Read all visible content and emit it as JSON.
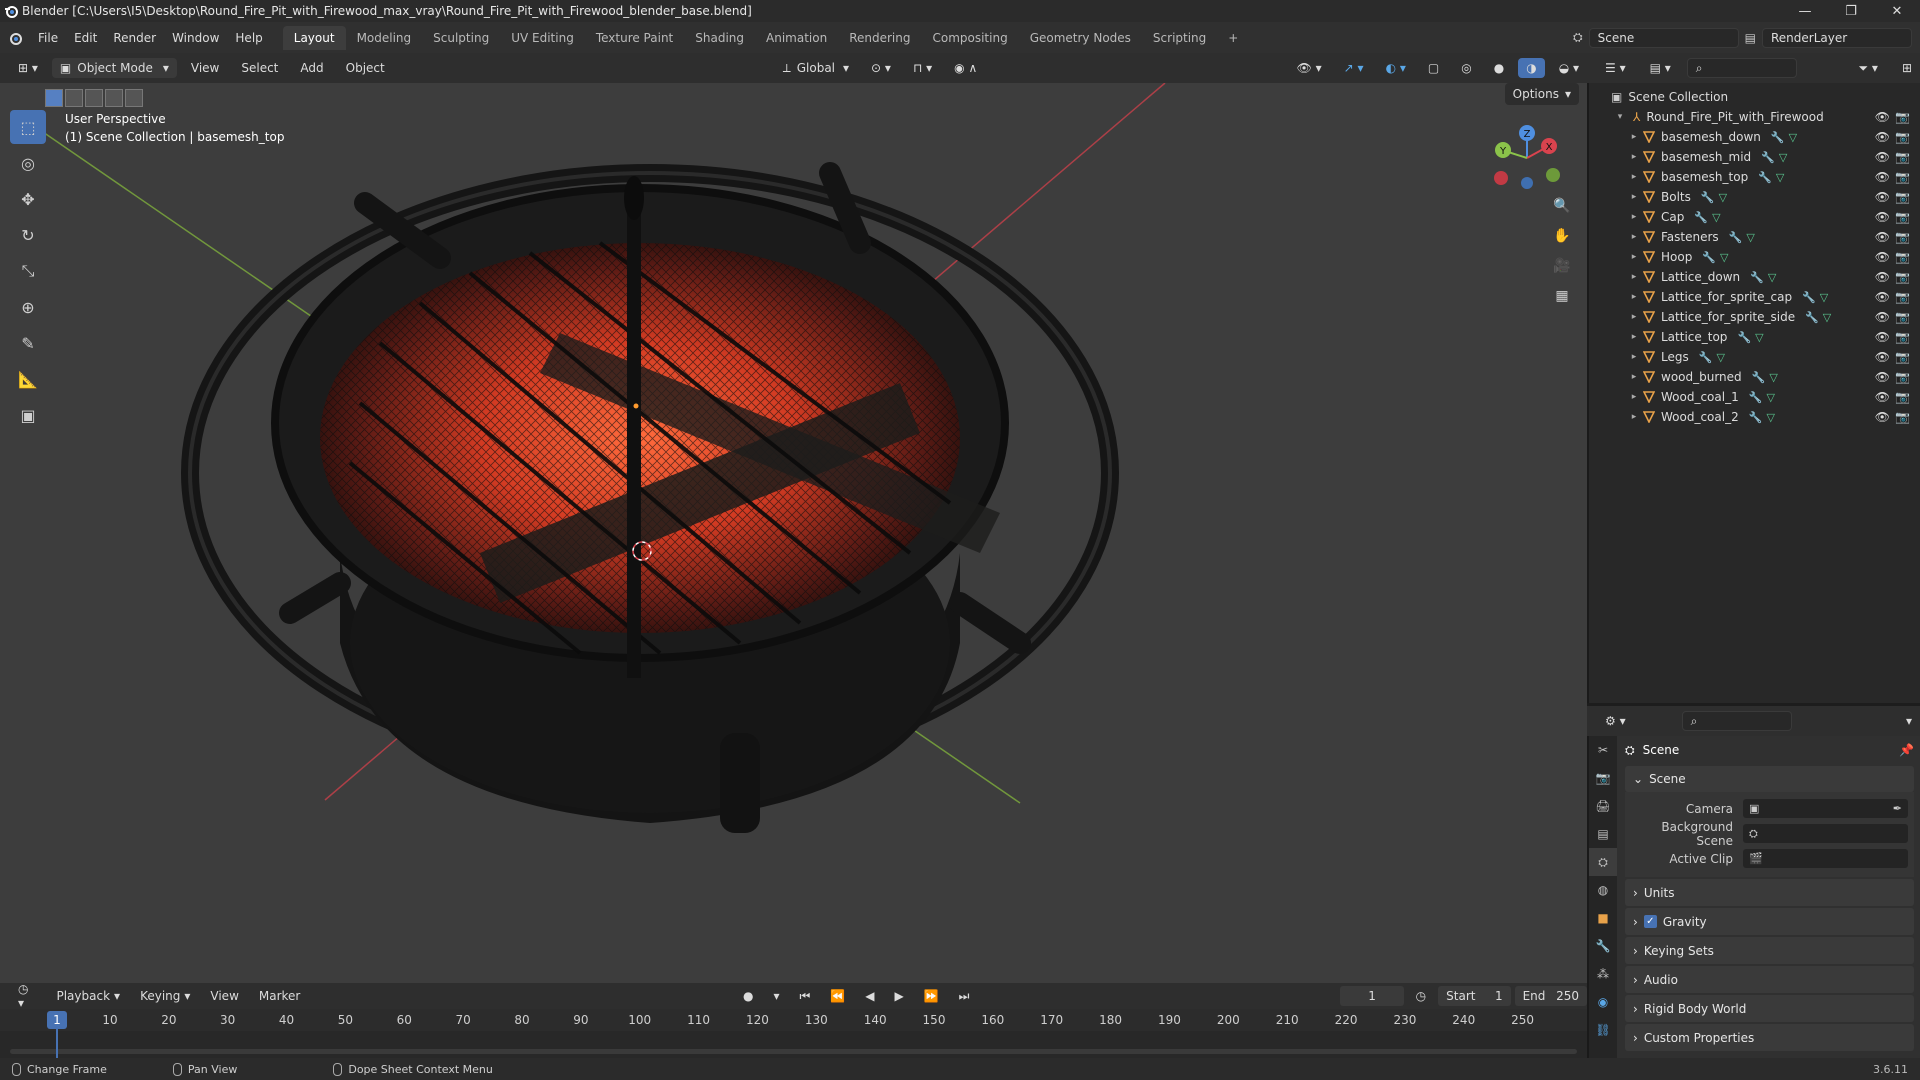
{
  "window": {
    "title": "Blender [C:\\Users\\I5\\Desktop\\Round_Fire_Pit_with_Firewood_max_vray\\Round_Fire_Pit_with_Firewood_blender_base.blend]",
    "controls": [
      "—",
      "❐",
      "✕"
    ]
  },
  "menu": {
    "items": [
      "File",
      "Edit",
      "Render",
      "Window",
      "Help"
    ],
    "workspaces": [
      "Layout",
      "Modeling",
      "Sculpting",
      "UV Editing",
      "Texture Paint",
      "Shading",
      "Animation",
      "Rendering",
      "Compositing",
      "Geometry Nodes",
      "Scripting",
      "+"
    ],
    "active_workspace": "Layout",
    "scene": "Scene",
    "view_layer": "RenderLayer"
  },
  "viewport_header": {
    "mode": "Object Mode",
    "menus": [
      "View",
      "Select",
      "Add",
      "Object"
    ],
    "transform_orientation": "Global",
    "options": "Options"
  },
  "viewport": {
    "perspective": "User Perspective",
    "context": "(1) Scene Collection | basemesh_top",
    "gizmo_axes": [
      "X",
      "Y",
      "Z"
    ]
  },
  "outliner": {
    "root": "Scene Collection",
    "collection": "Round_Fire_Pit_with_Firewood",
    "objects": [
      "basemesh_down",
      "basemesh_mid",
      "basemesh_top",
      "Bolts",
      "Cap",
      "Fasteners",
      "Hoop",
      "Lattice_down",
      "Lattice_for_sprite_cap",
      "Lattice_for_sprite_side",
      "Lattice_top",
      "Legs",
      "wood_burned",
      "Wood_coal_1",
      "Wood_coal_2"
    ],
    "selected": "basemesh_top"
  },
  "properties": {
    "context_title": "Scene",
    "panel": "Scene",
    "fields": [
      {
        "label": "Camera",
        "value": ""
      },
      {
        "label": "Background Scene",
        "value": ""
      },
      {
        "label": "Active Clip",
        "value": ""
      }
    ],
    "subpanels": [
      "Units",
      "Gravity",
      "Keying Sets",
      "Audio",
      "Rigid Body World",
      "Custom Properties"
    ],
    "gravity_checked": true
  },
  "timeline": {
    "menus": [
      "Playback",
      "Keying",
      "View",
      "Marker"
    ],
    "current_frame": "1",
    "start_label": "Start",
    "start": "1",
    "end_label": "End",
    "end": "250",
    "ticks": [
      "10",
      "20",
      "30",
      "40",
      "50",
      "60",
      "70",
      "80",
      "90",
      "100",
      "110",
      "120",
      "130",
      "140",
      "150",
      "160",
      "170",
      "180",
      "190",
      "200",
      "210",
      "220",
      "230",
      "240",
      "250"
    ],
    "playhead_label": "1"
  },
  "statusbar": {
    "hints": [
      "Change Frame",
      "Pan View",
      "Dope Sheet Context Menu"
    ],
    "version": "3.6.11"
  },
  "colors": {
    "accent": "#4772b3",
    "x_axis": "#d9434e",
    "y_axis": "#8bc34a",
    "z_axis": "#4f8fe0",
    "ember": "#e84a2c"
  }
}
